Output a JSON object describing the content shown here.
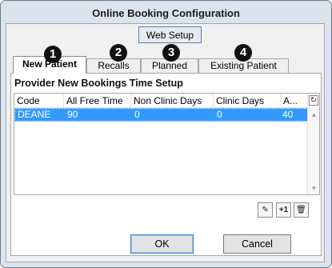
{
  "dialog": {
    "title": "Online Booking Configuration",
    "web_setup_label": "Web Setup",
    "tabs": [
      {
        "label": "New Patient",
        "badge": "1",
        "active": true
      },
      {
        "label": "Recalls",
        "badge": "2",
        "active": false
      },
      {
        "label": "Planned",
        "badge": "3",
        "active": false
      },
      {
        "label": "Existing Patient",
        "badge": "4",
        "active": false
      }
    ],
    "section_title": "Provider New Bookings Time Setup",
    "grid": {
      "columns": [
        "Code",
        "All Free Time",
        "Non Clinic Days",
        "Clinic Days",
        "A..."
      ],
      "rows": [
        [
          "DEANE",
          "90",
          "0",
          "0",
          "40"
        ]
      ],
      "refresh_glyph": "↻"
    },
    "row_buttons": {
      "edit_glyph": "✎",
      "add_label": "+1",
      "delete_glyph": "🗑"
    },
    "ok_label": "OK",
    "cancel_label": "Cancel"
  },
  "colors": {
    "selection": "#3399ff",
    "badge": "#111111",
    "frame": "#dbe4ee"
  }
}
